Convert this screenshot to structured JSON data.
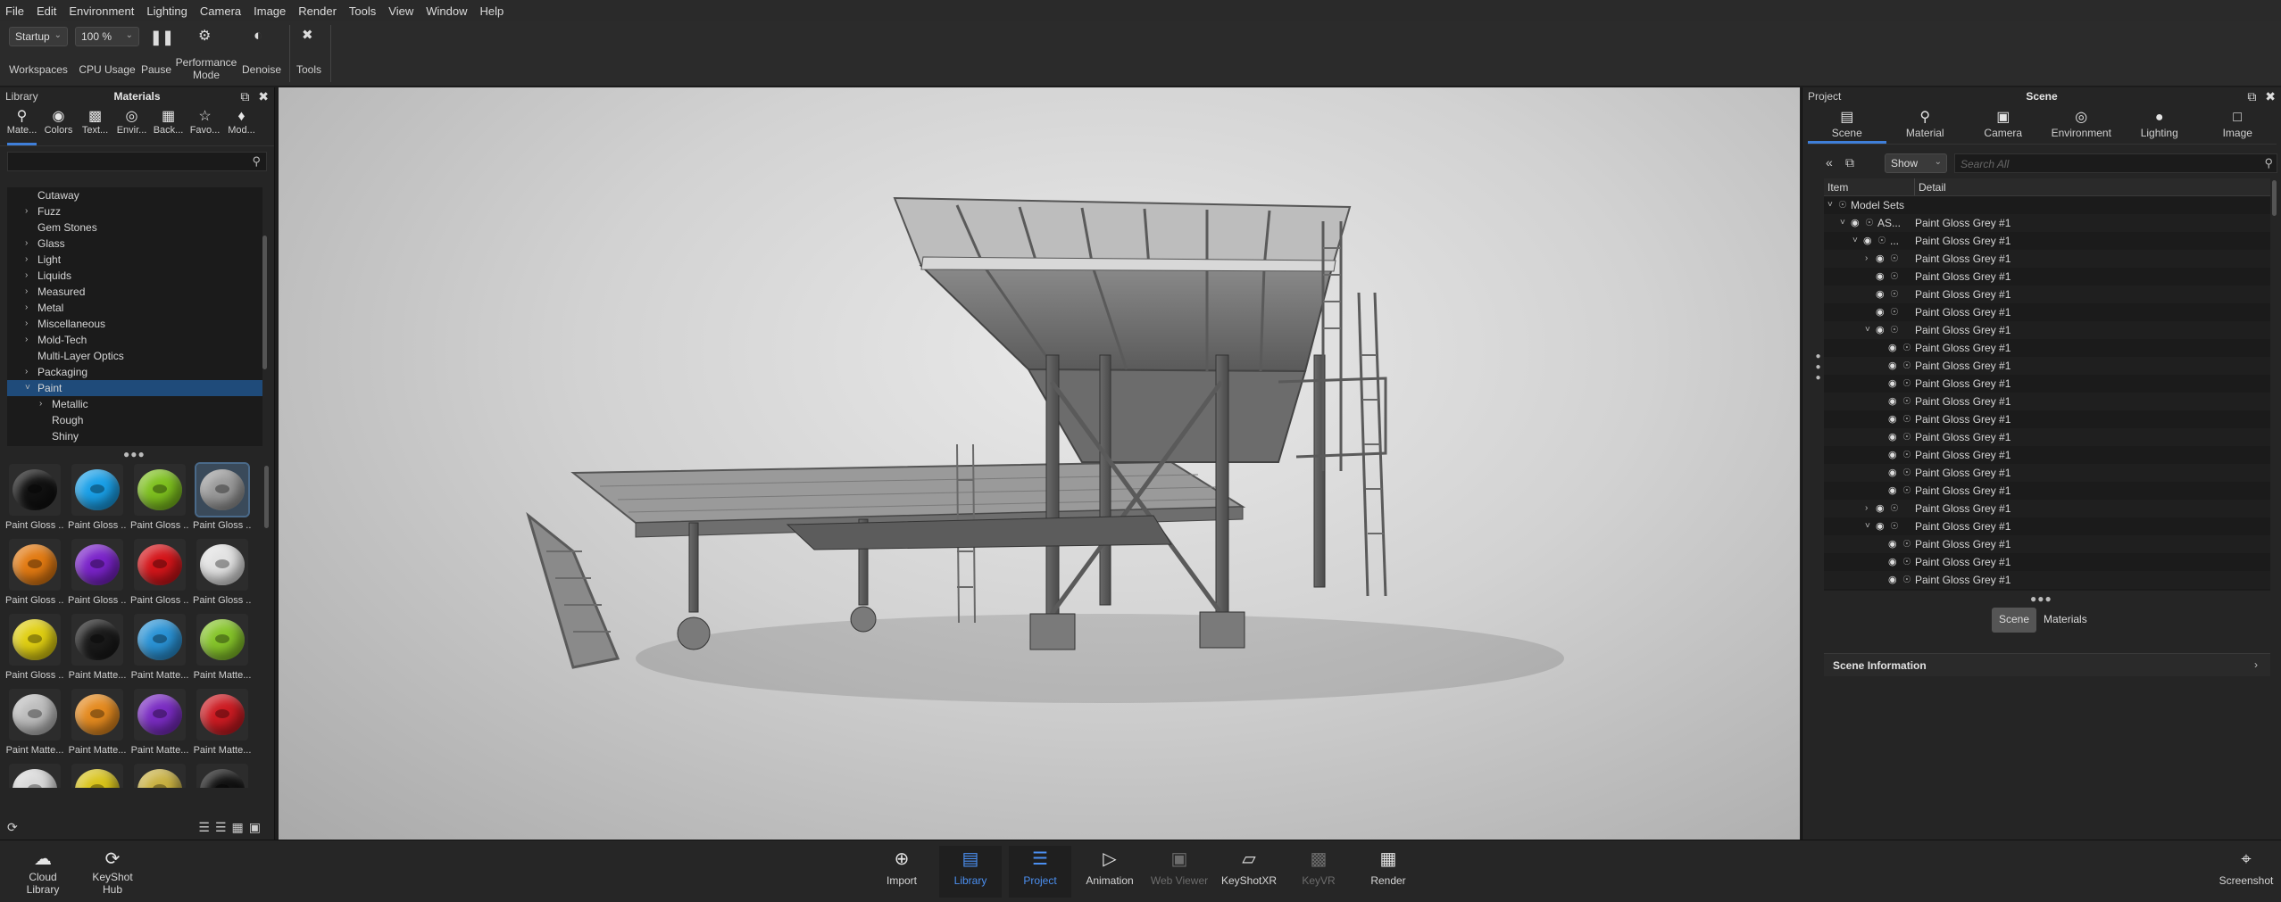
{
  "menu": [
    "File",
    "Edit",
    "Environment",
    "Lighting",
    "Camera",
    "Image",
    "Render",
    "Tools",
    "View",
    "Window",
    "Help"
  ],
  "toolbar": {
    "workspace_value": "Startup",
    "workspace_label": "Workspaces",
    "cpu_value": "100 %",
    "cpu_label": "CPU Usage",
    "pause_label": "Pause",
    "performance_label_1": "Performance",
    "performance_label_2": "Mode",
    "denoise_label": "Denoise",
    "tools_label": "Tools"
  },
  "library": {
    "title": "Library",
    "header": "Materials",
    "tabs": [
      "Mate...",
      "Colors",
      "Text...",
      "Envir...",
      "Back...",
      "Favo...",
      "Mod..."
    ],
    "tree": [
      {
        "label": "Cutaway",
        "arrow": ""
      },
      {
        "label": "Fuzz",
        "arrow": ">"
      },
      {
        "label": "Gem Stones",
        "arrow": ""
      },
      {
        "label": "Glass",
        "arrow": ">"
      },
      {
        "label": "Light",
        "arrow": ">"
      },
      {
        "label": "Liquids",
        "arrow": ">"
      },
      {
        "label": "Measured",
        "arrow": ">"
      },
      {
        "label": "Metal",
        "arrow": ">"
      },
      {
        "label": "Miscellaneous",
        "arrow": ">"
      },
      {
        "label": "Mold-Tech",
        "arrow": ">"
      },
      {
        "label": "Multi-Layer Optics",
        "arrow": ""
      },
      {
        "label": "Packaging",
        "arrow": ">"
      },
      {
        "label": "Paint",
        "arrow": "v"
      },
      {
        "label": "Metallic",
        "arrow": ">"
      },
      {
        "label": "Rough",
        "arrow": ""
      },
      {
        "label": "Shiny",
        "arrow": ""
      }
    ],
    "thumbnails": [
      {
        "label": "Paint Gloss ...",
        "color": "#111111"
      },
      {
        "label": "Paint Gloss ...",
        "color": "#1aa0e8"
      },
      {
        "label": "Paint Gloss ...",
        "color": "#7ec11f"
      },
      {
        "label": "Paint Gloss ...",
        "color": "#9a9a9a"
      },
      {
        "label": "Paint Gloss ...",
        "color": "#e27a12"
      },
      {
        "label": "Paint Gloss ...",
        "color": "#7a23c9"
      },
      {
        "label": "Paint Gloss ...",
        "color": "#d4151a"
      },
      {
        "label": "Paint Gloss ...",
        "color": "#e2e2e2"
      },
      {
        "label": "Paint Gloss ...",
        "color": "#e0cf12"
      },
      {
        "label": "Paint Matte...",
        "color": "#1a1a1a"
      },
      {
        "label": "Paint Matte...",
        "color": "#2a93d6"
      },
      {
        "label": "Paint Matte...",
        "color": "#86c52a"
      },
      {
        "label": "Paint Matte...",
        "color": "#bdbdbd"
      },
      {
        "label": "Paint Matte...",
        "color": "#e48a1f"
      },
      {
        "label": "Paint Matte...",
        "color": "#7a2cc2"
      },
      {
        "label": "Paint Matte...",
        "color": "#cc1b22"
      },
      {
        "label": "",
        "color": "#d8d8d8"
      },
      {
        "label": "",
        "color": "#d8c31a"
      },
      {
        "label": "",
        "color": "#c8b040"
      },
      {
        "label": "",
        "color": "#111111"
      }
    ]
  },
  "right": {
    "title": "Project",
    "header": "Scene",
    "tabs": [
      "Scene",
      "Material",
      "Camera",
      "Environment",
      "Lighting",
      "Image"
    ],
    "show_value": "Show",
    "search_placeholder": "Search All",
    "columns": [
      "Item",
      "Detail"
    ],
    "rows": [
      {
        "indent": 0,
        "arrow": "v",
        "eye": false,
        "item": "Model Sets",
        "detail": ""
      },
      {
        "indent": 1,
        "arrow": "v",
        "eye": true,
        "item": "AS...",
        "detail": "Paint Gloss Grey #1"
      },
      {
        "indent": 2,
        "arrow": "v",
        "eye": true,
        "item": "...",
        "detail": "Paint Gloss Grey #1"
      },
      {
        "indent": 3,
        "arrow": ">",
        "eye": true,
        "item": "",
        "detail": "Paint Gloss Grey #1"
      },
      {
        "indent": 3,
        "arrow": "",
        "eye": true,
        "item": "",
        "detail": "Paint Gloss Grey #1"
      },
      {
        "indent": 3,
        "arrow": "",
        "eye": true,
        "item": "",
        "detail": "Paint Gloss Grey #1"
      },
      {
        "indent": 3,
        "arrow": "",
        "eye": true,
        "item": "",
        "detail": "Paint Gloss Grey #1"
      },
      {
        "indent": 3,
        "arrow": "v",
        "eye": true,
        "item": "",
        "detail": "Paint Gloss Grey #1"
      },
      {
        "indent": 4,
        "arrow": "",
        "eye": true,
        "item": "",
        "detail": "Paint Gloss Grey #1"
      },
      {
        "indent": 4,
        "arrow": "",
        "eye": true,
        "item": "",
        "detail": "Paint Gloss Grey #1"
      },
      {
        "indent": 4,
        "arrow": "",
        "eye": true,
        "item": "",
        "detail": "Paint Gloss Grey #1"
      },
      {
        "indent": 4,
        "arrow": "",
        "eye": true,
        "item": "",
        "detail": "Paint Gloss Grey #1"
      },
      {
        "indent": 4,
        "arrow": "",
        "eye": true,
        "item": "",
        "detail": "Paint Gloss Grey #1"
      },
      {
        "indent": 4,
        "arrow": "",
        "eye": true,
        "item": "",
        "detail": "Paint Gloss Grey #1"
      },
      {
        "indent": 4,
        "arrow": "",
        "eye": true,
        "item": "",
        "detail": "Paint Gloss Grey #1"
      },
      {
        "indent": 4,
        "arrow": "",
        "eye": true,
        "item": "",
        "detail": "Paint Gloss Grey #1"
      },
      {
        "indent": 4,
        "arrow": "",
        "eye": true,
        "item": "",
        "detail": "Paint Gloss Grey #1"
      },
      {
        "indent": 3,
        "arrow": ">",
        "eye": true,
        "item": "",
        "detail": "Paint Gloss Grey #1"
      },
      {
        "indent": 3,
        "arrow": "v",
        "eye": true,
        "item": "",
        "detail": "Paint Gloss Grey #1"
      },
      {
        "indent": 4,
        "arrow": "",
        "eye": true,
        "item": "",
        "detail": "Paint Gloss Grey #1"
      },
      {
        "indent": 4,
        "arrow": "",
        "eye": true,
        "item": "",
        "detail": "Paint Gloss Grey #1"
      },
      {
        "indent": 4,
        "arrow": "",
        "eye": true,
        "item": "",
        "detail": "Paint Gloss Grey #1"
      }
    ],
    "subtabs": [
      "Scene",
      "Materials"
    ],
    "scene_info": "Scene Information"
  },
  "bottom": {
    "cloud_1": "Cloud",
    "cloud_2": "Library",
    "hub_1": "KeyShot",
    "hub_2": "Hub",
    "items": [
      {
        "label": "Import",
        "state": "normal"
      },
      {
        "label": "Library",
        "state": "active"
      },
      {
        "label": "Project",
        "state": "active"
      },
      {
        "label": "Animation",
        "state": "normal"
      },
      {
        "label": "Web Viewer",
        "state": "dim"
      },
      {
        "label": "KeyShotXR",
        "state": "normal"
      },
      {
        "label": "KeyVR",
        "state": "dim"
      },
      {
        "label": "Render",
        "state": "normal"
      }
    ],
    "screenshot": "Screenshot"
  },
  "colors": {
    "accent": "#3f7fd9",
    "selection": "#1f4b7a"
  }
}
